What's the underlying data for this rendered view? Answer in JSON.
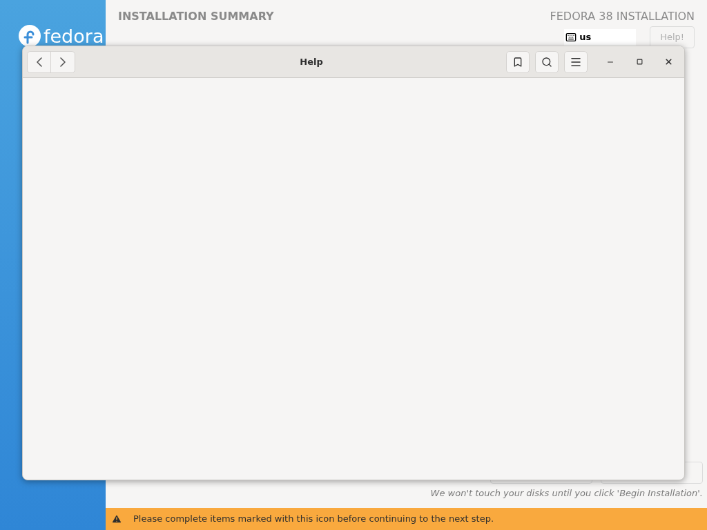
{
  "sidebar": {
    "logo_text": "fedora"
  },
  "header": {
    "title": "INSTALLATION SUMMARY",
    "product": "FEDORA 38 INSTALLATION",
    "keyboard_layout": "us",
    "help_button": "Help!"
  },
  "footer": {
    "note": "We won't touch your disks until you click 'Begin Installation'."
  },
  "warning_bar": {
    "message": "Please complete items marked with this icon before continuing to the next step."
  },
  "help_window": {
    "title": "Help"
  }
}
